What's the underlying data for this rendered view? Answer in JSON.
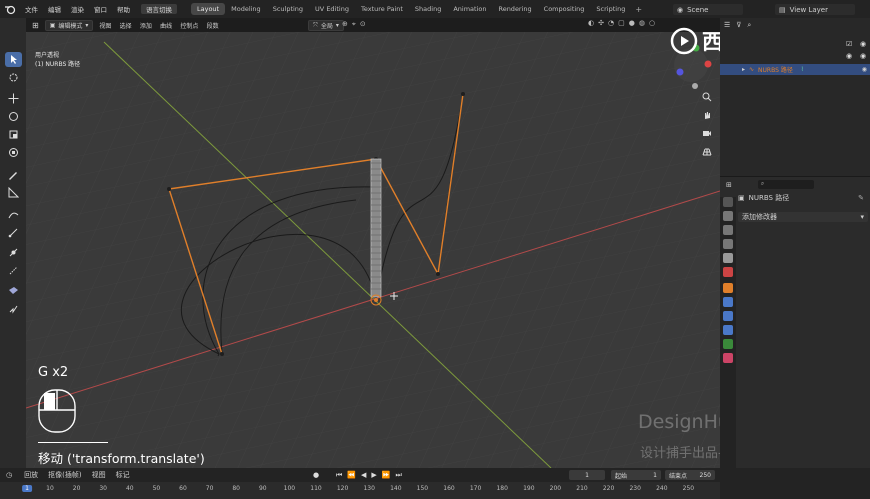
{
  "topbar": {
    "menus": [
      "文件",
      "编辑",
      "渲染",
      "窗口",
      "帮助"
    ],
    "lang_button": "语言切换",
    "workspaces": [
      "Layout",
      "Modeling",
      "Sculpting",
      "UV Editing",
      "Texture Paint",
      "Shading",
      "Animation",
      "Rendering",
      "Compositing",
      "Scripting"
    ],
    "active_workspace": "Layout",
    "scene": "Scene",
    "view_layer": "View Layer"
  },
  "viewport_header": {
    "mode": "编辑模式",
    "menus": [
      "视图",
      "选择",
      "添加",
      "曲线",
      "控制点",
      "段数"
    ],
    "transform_orientation": "全局"
  },
  "viewport": {
    "view_name": "用户透视",
    "object_name": "(1) NURBS 路径"
  },
  "operator_overlay": {
    "key_hint": "G x2",
    "operator": "移动 ('transform.translate')"
  },
  "outliner": {
    "object": "NURBS 路径"
  },
  "properties": {
    "object_name": "NURBS 路径",
    "add_modifier": "添加修改器"
  },
  "timeline": {
    "menus": [
      "回放",
      "抠像(插帧)",
      "视图",
      "标记"
    ],
    "current_frame": "1",
    "start_label": "起始",
    "start": "1",
    "end_label": "结束点",
    "end": "250",
    "ticks": [
      "1",
      "10",
      "20",
      "30",
      "40",
      "50",
      "60",
      "70",
      "80",
      "90",
      "100",
      "110",
      "120",
      "130",
      "140",
      "150",
      "160",
      "170",
      "180",
      "190",
      "200",
      "210",
      "220",
      "230",
      "240",
      "250"
    ]
  },
  "watermarks": {
    "brand": "西瓜视频",
    "studio": "DesignHunting",
    "course": "设计捕手出品-基础部分"
  },
  "colors": {
    "accent": "#4a78c8",
    "curve_handle": "#e07f2a",
    "x_axis": "#b24a4a",
    "y_axis": "#7a9a3a"
  }
}
